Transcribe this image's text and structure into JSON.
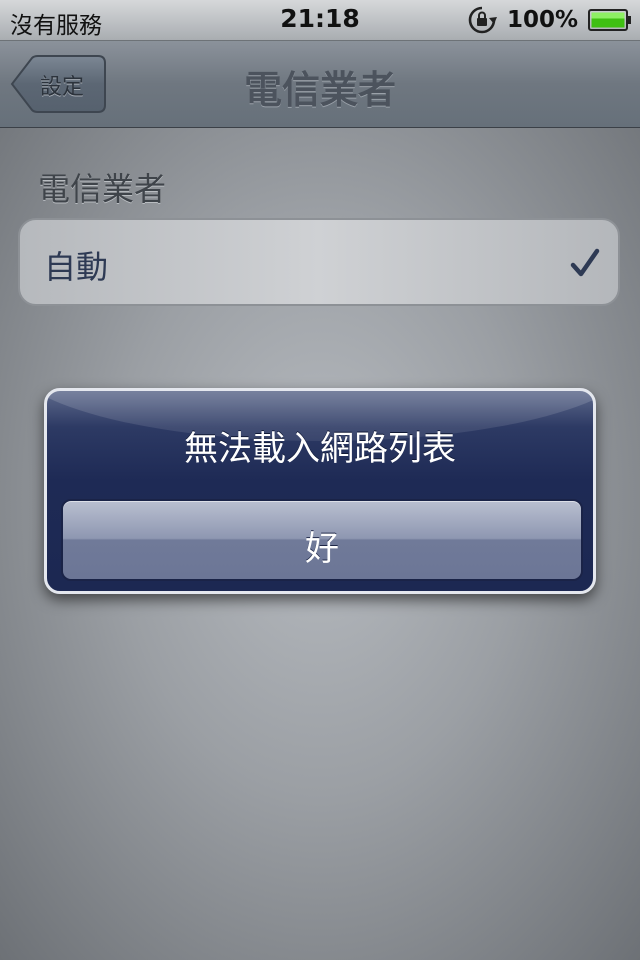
{
  "status_bar": {
    "carrier": "沒有服務",
    "time": "21:18",
    "battery": "100%",
    "icons": [
      "orientation-lock-icon",
      "battery-icon"
    ]
  },
  "nav_bar": {
    "back_label": "設定",
    "title": "電信業者"
  },
  "section": {
    "header": "電信業者",
    "cell_label": "自動",
    "cell_checked": true
  },
  "alert": {
    "title": "無法載入網路列表",
    "button_label": "好"
  },
  "colors": {
    "alert_background": "#1e2a55",
    "check_color": "#2e3a54",
    "battery_green": "#3fc012"
  }
}
